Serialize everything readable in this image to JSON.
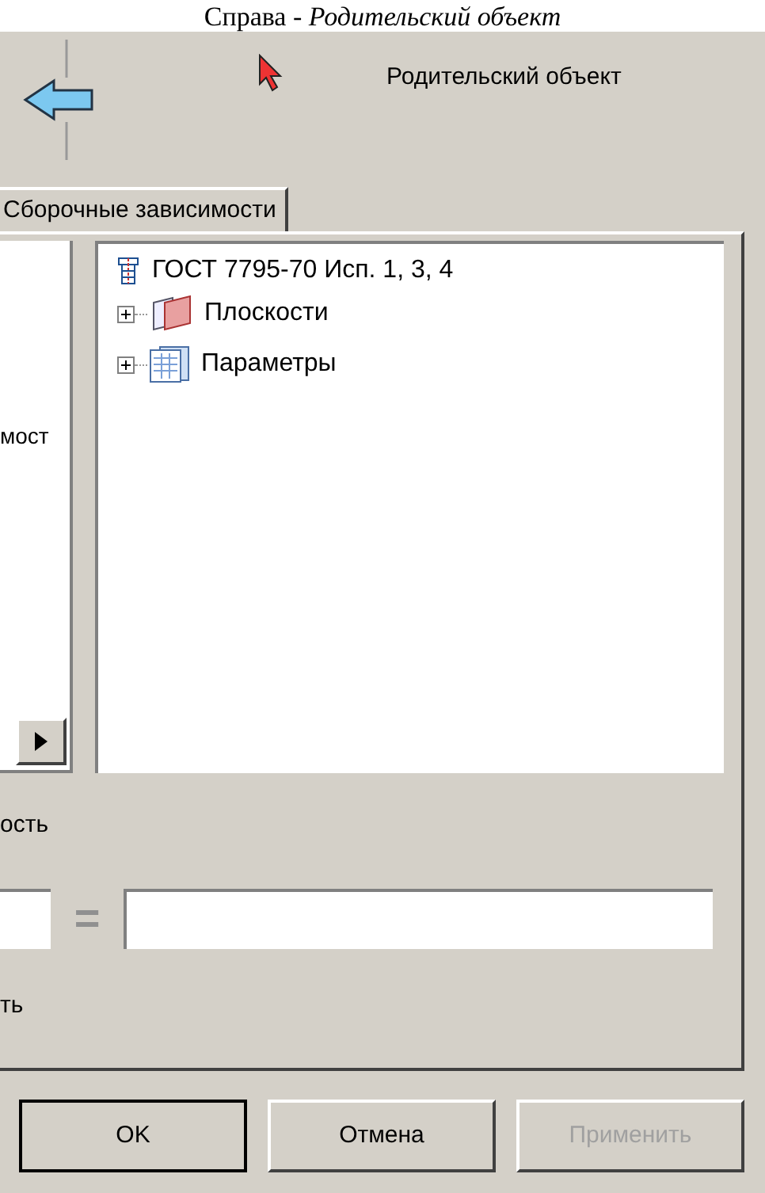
{
  "caption": "Справа - *Родительский объект*",
  "parent_label": "Родительский объект",
  "tabs": [
    {
      "label": "Сборочные зависимости",
      "selected": true
    }
  ],
  "left_list": {
    "item_text": "мост"
  },
  "tree": [
    {
      "label": "ГОСТ 7795-70 Исп. 1, 3, 4",
      "kind": "part",
      "children": [
        {
          "label": "Плоскости",
          "kind": "planes",
          "expanded": false
        },
        {
          "label": "Параметры",
          "kind": "params",
          "expanded": false
        }
      ]
    }
  ],
  "label_1": "ость",
  "equation": {
    "sign": "="
  },
  "label_2": "ть",
  "buttons": [
    {
      "label": "OK",
      "default": true,
      "disabled": false
    },
    {
      "label": "Отмена",
      "default": false,
      "disabled": false
    },
    {
      "label": "Применить",
      "default": false,
      "disabled": true
    }
  ]
}
